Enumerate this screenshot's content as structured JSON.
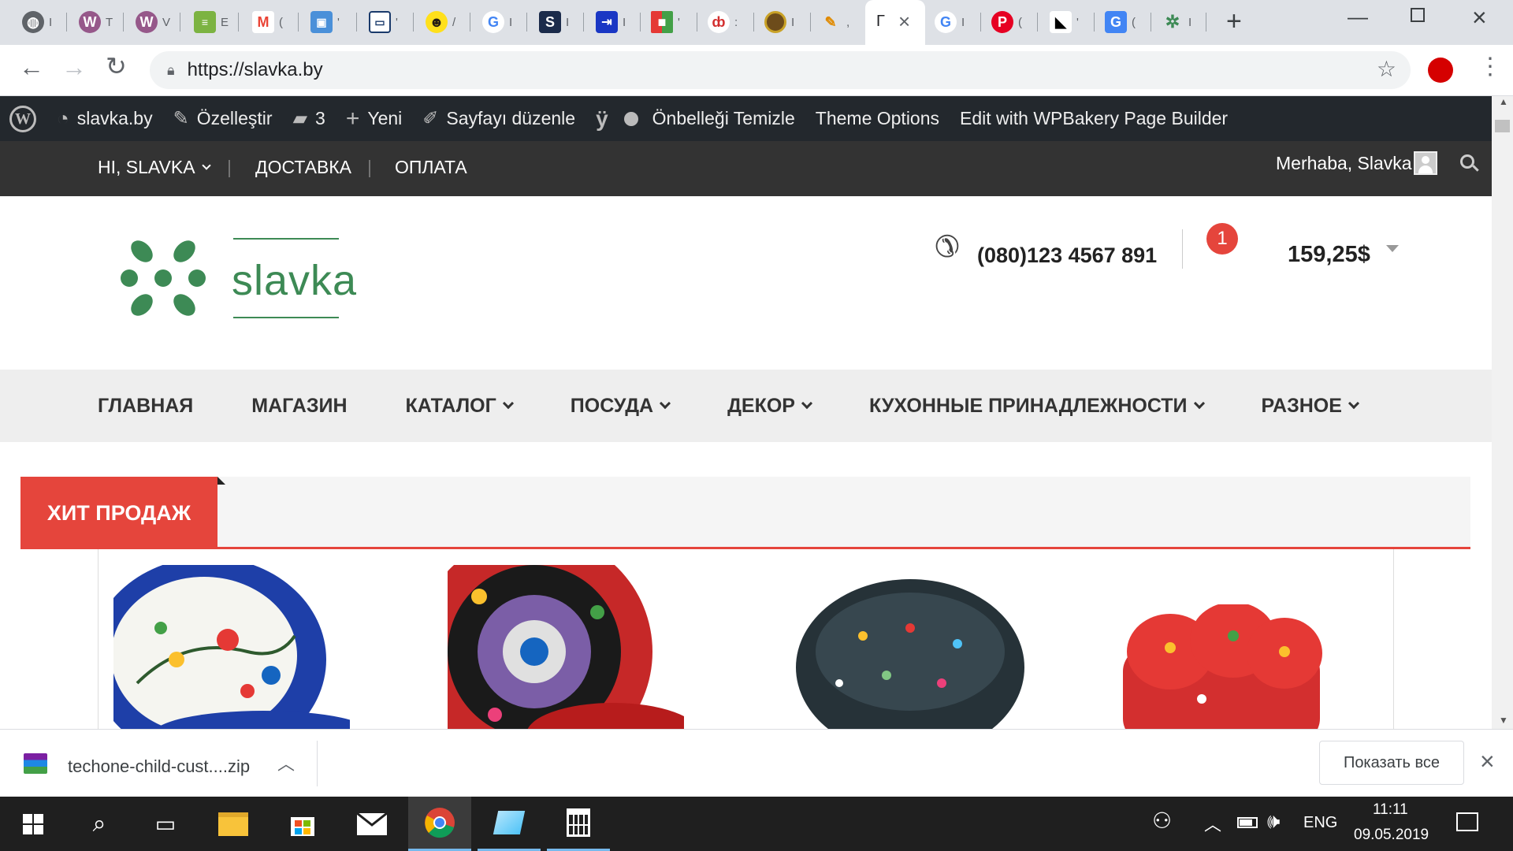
{
  "browser": {
    "tabs": [
      {
        "icon": "globe-icon",
        "label": "I"
      },
      {
        "icon": "woo-icon",
        "label": "T"
      },
      {
        "icon": "woo-icon",
        "label": "V"
      },
      {
        "icon": "sheet-icon",
        "label": "E"
      },
      {
        "icon": "gmail-icon",
        "label": "("
      },
      {
        "icon": "site-icon",
        "label": "'"
      },
      {
        "icon": "screen-icon",
        "label": "'"
      },
      {
        "icon": "mailchimp-icon",
        "label": "/"
      },
      {
        "icon": "google-icon",
        "label": "I"
      },
      {
        "icon": "s-icon",
        "label": "I"
      },
      {
        "icon": "form-icon",
        "label": "I"
      },
      {
        "icon": "puzzle-icon",
        "label": "'"
      },
      {
        "icon": "d-icon",
        "label": ":"
      },
      {
        "icon": "badge-icon",
        "label": "I"
      },
      {
        "icon": "pen-icon",
        "label": ","
      }
    ],
    "active_tab_label": "Γ",
    "tabs_after": [
      {
        "icon": "google-icon",
        "label": "I"
      },
      {
        "icon": "pinterest-icon",
        "label": "("
      },
      {
        "icon": "bird-icon",
        "label": "'"
      },
      {
        "icon": "translate-icon",
        "label": "("
      },
      {
        "icon": "slavka-icon",
        "label": "I"
      }
    ],
    "url": "https://slavka.by"
  },
  "adminbar": {
    "site": "slavka.by",
    "customize": "Özelleştir",
    "comments": "3",
    "new": "Yeni",
    "edit_page": "Sayfayı düzenle",
    "clear_cache": "Önbelleği Temizle",
    "theme_options": "Theme Options",
    "wpbakery": "Edit with WPBakery Page Builder"
  },
  "topbar": {
    "greeting_menu": "HI, SLAVKA",
    "delivery": "ДОСТАВКА",
    "payment": "ОПЛАТА",
    "welcome": "Merhaba, Slavka"
  },
  "header": {
    "logo_text": "slavka",
    "phone": "(080)123 4567 891",
    "cart_count": "1",
    "cart_total": "159,25$",
    "colors": {
      "logo_green": "#3d8a55",
      "accent_red": "#e5453c"
    }
  },
  "nav": {
    "items": [
      {
        "label": "ГЛАВНАЯ",
        "dropdown": false
      },
      {
        "label": "МАГАЗИН",
        "dropdown": false
      },
      {
        "label": "КАТАЛОГ",
        "dropdown": true
      },
      {
        "label": "ПОСУДА",
        "dropdown": true
      },
      {
        "label": "ДЕКОР",
        "dropdown": true
      },
      {
        "label": "КУХОННЫЕ ПРИНАДЛЕЖНОСТИ",
        "dropdown": true
      },
      {
        "label": "РАЗНОЕ",
        "dropdown": true
      }
    ]
  },
  "section": {
    "title": "ХИТ ПРОДАЖ"
  },
  "download": {
    "filename": "techone-child-cust....zip",
    "show_all": "Показать все"
  },
  "taskbar": {
    "language": "ENG",
    "time": "11:11",
    "date": "09.05.2019"
  }
}
